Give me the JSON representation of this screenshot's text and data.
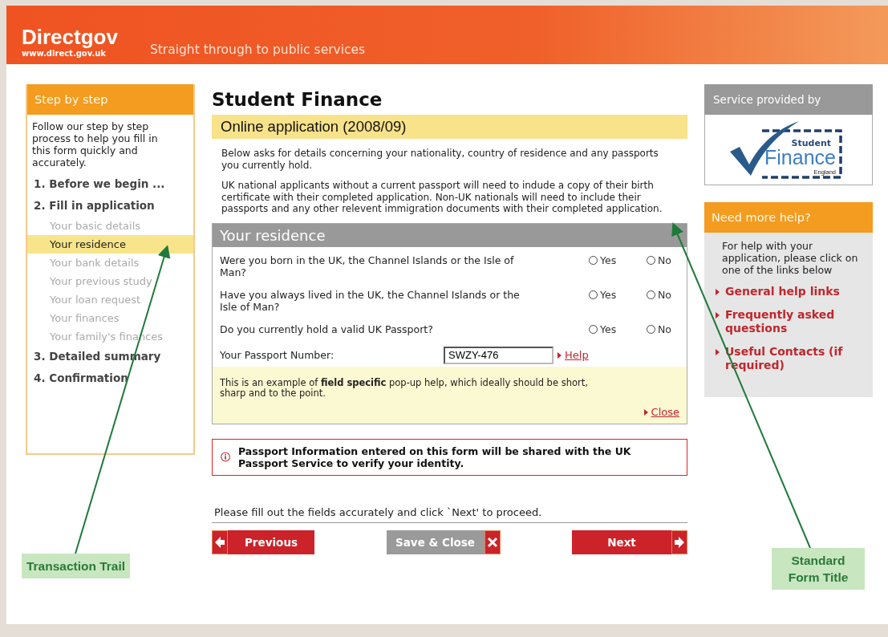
{
  "header": {
    "brand": "Directgov",
    "url": "www.direct.gov.uk",
    "tagline": "Straight through to public services"
  },
  "sidebar": {
    "title": "Step by step",
    "intro": "Follow our step by step process to help you fill in this form quickly and accurately.",
    "steps": [
      {
        "label": "1. Before we begin ...",
        "selected": false
      },
      {
        "label": "2. Fill in application",
        "selected": false,
        "children": [
          {
            "label": "Your basic details",
            "selected": false
          },
          {
            "label": "Your residence",
            "selected": true
          },
          {
            "label": "Your bank details",
            "selected": false
          },
          {
            "label": "Your previous study",
            "selected": false
          },
          {
            "label": "Your loan request",
            "selected": false
          },
          {
            "label": "Your finances",
            "selected": false
          },
          {
            "label": "Your family's finances",
            "selected": false
          }
        ]
      },
      {
        "label": "3. Detailed summary",
        "selected": false
      },
      {
        "label": "4. Confirmation",
        "selected": false
      }
    ]
  },
  "main": {
    "title": "Student Finance",
    "subtitle": "Online application (2008/09)",
    "paragraphs": [
      "Below asks for details concerning your nationality, country of residence and any passports you currently hold.",
      "UK national applicants without a current passport will need to indude a copy of their birth certificate with their completed application. Non-UK nationals will need to include their passports and any other relevent immigration documents with their completed application."
    ],
    "form": {
      "title": "Your residence",
      "questions": [
        {
          "text": "Were you born in the UK, the Channel Islands or the Isle of Man?",
          "options": [
            {
              "label": "Yes",
              "selected": false
            },
            {
              "label": "No",
              "selected": false
            }
          ]
        },
        {
          "text": "Have you always lived in the UK, the Channel Islands or the Isle of Man?",
          "options": [
            {
              "label": "Yes",
              "selected": false
            },
            {
              "label": "No",
              "selected": false
            }
          ]
        },
        {
          "text": "Do you currently hold a valid UK Passport?",
          "options": [
            {
              "label": "Yes",
              "selected": false
            },
            {
              "label": "No",
              "selected": false
            }
          ]
        }
      ],
      "passport": {
        "label": "Your Passport Number:",
        "value": "SWZY-476",
        "help": "Help"
      },
      "popup": {
        "text": "This is an example of **field specific** pop-up help, which ideally should be short, sharp and to the point.",
        "close": "Close"
      }
    },
    "notice": "Passport Information entered on this form will be shared with the UK Passport Service to verify your identity.",
    "instruction": "Please fill out the fields accurately and click `Next' to proceed.",
    "buttons": {
      "previous": "Previous",
      "save": "Save & Close",
      "next": "Next"
    }
  },
  "right": {
    "provider_title": "Service provided by",
    "logo": {
      "line1": "Student",
      "line2": "Finance",
      "line3": "England"
    },
    "help_title": "Need more help?",
    "help_text": "For help with your application, please click on one of the links below",
    "links": [
      "General help links",
      "Frequently asked questions",
      "Useful Contacts (if required)"
    ]
  },
  "annotations": [
    {
      "text": "Transaction Trail"
    },
    {
      "text": "Standard Form Title"
    }
  ]
}
